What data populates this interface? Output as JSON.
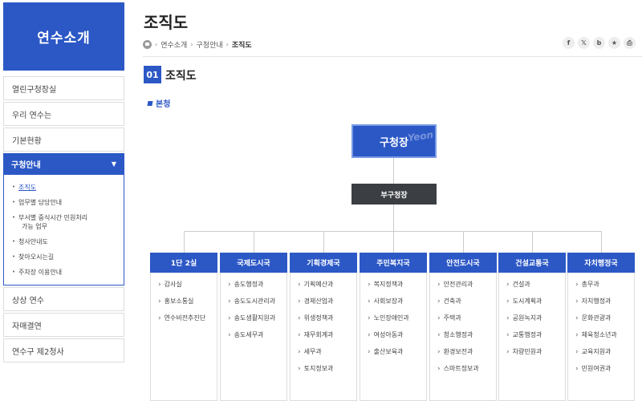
{
  "sidebar": {
    "title": "연수소개",
    "items_top": [
      "열린구청장실",
      "우리 연수는",
      "기본현황"
    ],
    "active": "구청안내",
    "sub_items": [
      {
        "label": "조직도",
        "current": true
      },
      {
        "label": "업무별 담당안내"
      },
      {
        "label": "부서별 중식시간 민원처리",
        "label2": "가능 업무"
      },
      {
        "label": "청사안내도"
      },
      {
        "label": "찾아오시는길"
      },
      {
        "label": "주차장 이용안내"
      }
    ],
    "items_bottom": [
      "상상 연수",
      "자매결연",
      "연수구 제2청사"
    ]
  },
  "page": {
    "title": "조직도",
    "breadcrumb": [
      "연수소개",
      "구청안내",
      "조직도"
    ],
    "share_icons": [
      "f",
      "𝕏",
      "b",
      "★",
      "⎙"
    ]
  },
  "section": {
    "number": "01",
    "title": "조직도",
    "subheading": "본청"
  },
  "org": {
    "chief": "구청장",
    "deputy": "부구청장",
    "columns": [
      {
        "head": "1단 2실",
        "items": [
          "감사실",
          "홍보소통실",
          "연수비전추진단"
        ]
      },
      {
        "head": "국제도시국",
        "items": [
          "송도행정과",
          "송도도시관리과",
          "송도생활지원과",
          "송도세무과"
        ]
      },
      {
        "head": "기획경제국",
        "items": [
          "기획예산과",
          "경제산업과",
          "위생정책과",
          "재무회계과",
          "세무과",
          "토지정보과"
        ]
      },
      {
        "head": "주민복지국",
        "items": [
          "복지정책과",
          "사회보장과",
          "노인장애인과",
          "여성아동과",
          "출산보육과"
        ]
      },
      {
        "head": "안전도시국",
        "items": [
          "안전관리과",
          "건축과",
          "주택과",
          "청소행정과",
          "환경보전과",
          "스마트정보과"
        ]
      },
      {
        "head": "건설교통국",
        "items": [
          "건설과",
          "도시계획과",
          "공원녹지과",
          "교통행정과",
          "차량민원과"
        ]
      },
      {
        "head": "자치행정국",
        "items": [
          "총무과",
          "자치행정과",
          "문화관광과",
          "체육청소년과",
          "교육지원과",
          "민원여권과"
        ]
      }
    ]
  }
}
